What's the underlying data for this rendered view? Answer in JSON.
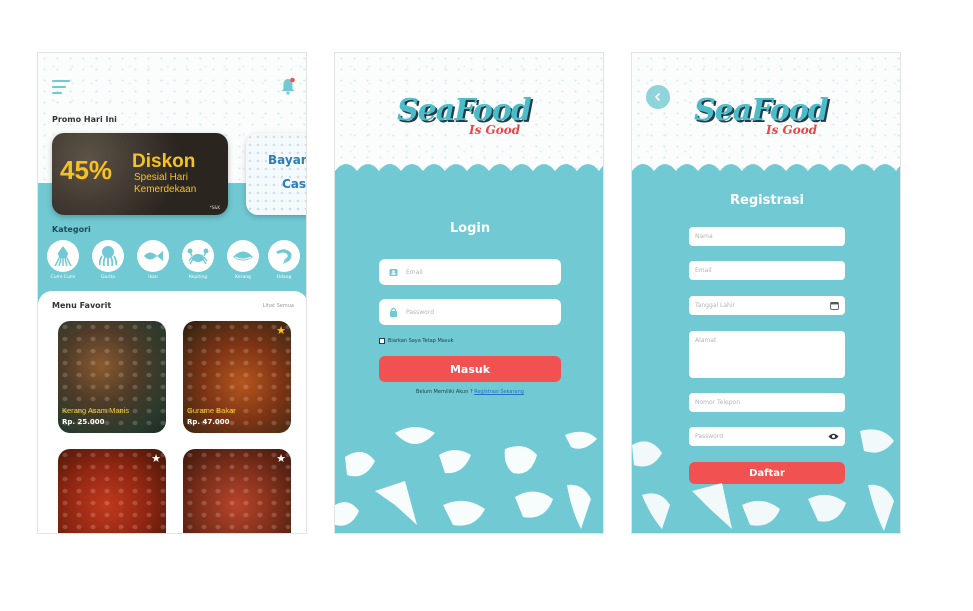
{
  "home": {
    "promo_title": "Promo Hari Ini",
    "promo1": {
      "percent": "45%",
      "line1": "Diskon",
      "line2": "Spesial Hari",
      "line3": "Kemerdekaan",
      "tiny": "*S&K"
    },
    "promo2": {
      "line1": "Bayar",
      "line2": "Cas"
    },
    "kategori_title": "Kategori",
    "categories": [
      {
        "label": "Cumi-Cumi",
        "icon": "squid-icon"
      },
      {
        "label": "Gurita",
        "icon": "octopus-icon"
      },
      {
        "label": "Ikan",
        "icon": "fish-icon"
      },
      {
        "label": "Kepiting",
        "icon": "crab-icon"
      },
      {
        "label": "Kerang",
        "icon": "clam-icon"
      },
      {
        "label": "Udang",
        "icon": "shrimp-icon"
      }
    ],
    "favorit_title": "Menu Favorit",
    "see_all": "Lihat Semua",
    "foods": [
      {
        "name": "Kerang Asam Manis",
        "price": "Rp. 25.000",
        "starred": true
      },
      {
        "name": "Gurame Bakar",
        "price": "Rp. 47.000",
        "starred": true
      },
      {
        "name": "",
        "price": "",
        "starred": false
      },
      {
        "name": "",
        "price": "",
        "starred": false
      }
    ]
  },
  "logo": {
    "brand": "SeaFood",
    "tagline": "Is Good"
  },
  "login": {
    "title": "Login",
    "email_placeholder": "Email",
    "password_placeholder": "Password",
    "remember_label": "Biarkan Saya Tetap Masuk",
    "submit_label": "Masuk",
    "no_account_text": "Belum Memiliki Akun ? ",
    "register_link": "Registrasi Sekarang"
  },
  "register": {
    "title": "Registrasi",
    "name_placeholder": "Nama",
    "email_placeholder": "Email",
    "dob_placeholder": "Tanggal Lahir",
    "address_placeholder": "Alamat",
    "phone_placeholder": "Nomor Telepon",
    "password_placeholder": "Password",
    "submit_label": "Daftar"
  },
  "colors": {
    "teal": "#71c9d3",
    "red": "#f25151",
    "gold": "#f7c21f"
  }
}
